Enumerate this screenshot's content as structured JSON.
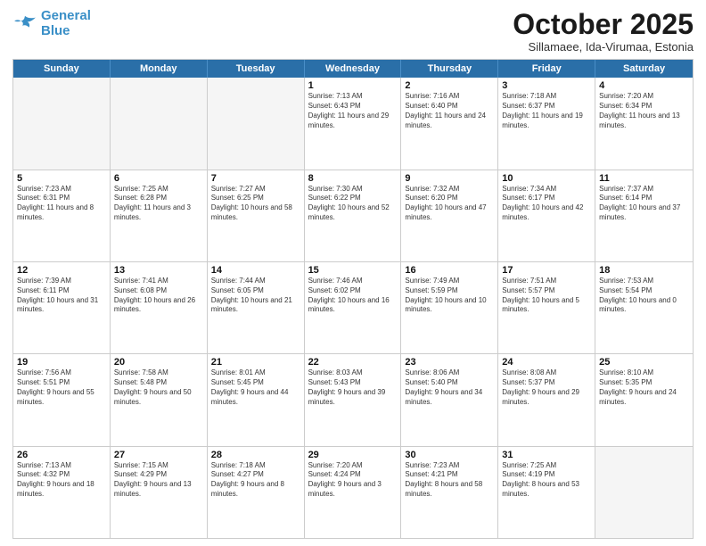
{
  "logo": {
    "line1": "General",
    "line2": "Blue"
  },
  "title": "October 2025",
  "subtitle": "Sillamaee, Ida-Virumaa, Estonia",
  "days": [
    "Sunday",
    "Monday",
    "Tuesday",
    "Wednesday",
    "Thursday",
    "Friday",
    "Saturday"
  ],
  "weeks": [
    [
      {
        "day": "",
        "empty": true
      },
      {
        "day": "",
        "empty": true
      },
      {
        "day": "",
        "empty": true
      },
      {
        "day": "1",
        "rise": "7:13 AM",
        "set": "6:43 PM",
        "daylight": "11 hours and 29 minutes."
      },
      {
        "day": "2",
        "rise": "7:16 AM",
        "set": "6:40 PM",
        "daylight": "11 hours and 24 minutes."
      },
      {
        "day": "3",
        "rise": "7:18 AM",
        "set": "6:37 PM",
        "daylight": "11 hours and 19 minutes."
      },
      {
        "day": "4",
        "rise": "7:20 AM",
        "set": "6:34 PM",
        "daylight": "11 hours and 13 minutes."
      }
    ],
    [
      {
        "day": "5",
        "rise": "7:23 AM",
        "set": "6:31 PM",
        "daylight": "11 hours and 8 minutes."
      },
      {
        "day": "6",
        "rise": "7:25 AM",
        "set": "6:28 PM",
        "daylight": "11 hours and 3 minutes."
      },
      {
        "day": "7",
        "rise": "7:27 AM",
        "set": "6:25 PM",
        "daylight": "10 hours and 58 minutes."
      },
      {
        "day": "8",
        "rise": "7:30 AM",
        "set": "6:22 PM",
        "daylight": "10 hours and 52 minutes."
      },
      {
        "day": "9",
        "rise": "7:32 AM",
        "set": "6:20 PM",
        "daylight": "10 hours and 47 minutes."
      },
      {
        "day": "10",
        "rise": "7:34 AM",
        "set": "6:17 PM",
        "daylight": "10 hours and 42 minutes."
      },
      {
        "day": "11",
        "rise": "7:37 AM",
        "set": "6:14 PM",
        "daylight": "10 hours and 37 minutes."
      }
    ],
    [
      {
        "day": "12",
        "rise": "7:39 AM",
        "set": "6:11 PM",
        "daylight": "10 hours and 31 minutes."
      },
      {
        "day": "13",
        "rise": "7:41 AM",
        "set": "6:08 PM",
        "daylight": "10 hours and 26 minutes."
      },
      {
        "day": "14",
        "rise": "7:44 AM",
        "set": "6:05 PM",
        "daylight": "10 hours and 21 minutes."
      },
      {
        "day": "15",
        "rise": "7:46 AM",
        "set": "6:02 PM",
        "daylight": "10 hours and 16 minutes."
      },
      {
        "day": "16",
        "rise": "7:49 AM",
        "set": "5:59 PM",
        "daylight": "10 hours and 10 minutes."
      },
      {
        "day": "17",
        "rise": "7:51 AM",
        "set": "5:57 PM",
        "daylight": "10 hours and 5 minutes."
      },
      {
        "day": "18",
        "rise": "7:53 AM",
        "set": "5:54 PM",
        "daylight": "10 hours and 0 minutes."
      }
    ],
    [
      {
        "day": "19",
        "rise": "7:56 AM",
        "set": "5:51 PM",
        "daylight": "9 hours and 55 minutes."
      },
      {
        "day": "20",
        "rise": "7:58 AM",
        "set": "5:48 PM",
        "daylight": "9 hours and 50 minutes."
      },
      {
        "day": "21",
        "rise": "8:01 AM",
        "set": "5:45 PM",
        "daylight": "9 hours and 44 minutes."
      },
      {
        "day": "22",
        "rise": "8:03 AM",
        "set": "5:43 PM",
        "daylight": "9 hours and 39 minutes."
      },
      {
        "day": "23",
        "rise": "8:06 AM",
        "set": "5:40 PM",
        "daylight": "9 hours and 34 minutes."
      },
      {
        "day": "24",
        "rise": "8:08 AM",
        "set": "5:37 PM",
        "daylight": "9 hours and 29 minutes."
      },
      {
        "day": "25",
        "rise": "8:10 AM",
        "set": "5:35 PM",
        "daylight": "9 hours and 24 minutes."
      }
    ],
    [
      {
        "day": "26",
        "rise": "7:13 AM",
        "set": "4:32 PM",
        "daylight": "9 hours and 18 minutes."
      },
      {
        "day": "27",
        "rise": "7:15 AM",
        "set": "4:29 PM",
        "daylight": "9 hours and 13 minutes."
      },
      {
        "day": "28",
        "rise": "7:18 AM",
        "set": "4:27 PM",
        "daylight": "9 hours and 8 minutes."
      },
      {
        "day": "29",
        "rise": "7:20 AM",
        "set": "4:24 PM",
        "daylight": "9 hours and 3 minutes."
      },
      {
        "day": "30",
        "rise": "7:23 AM",
        "set": "4:21 PM",
        "daylight": "8 hours and 58 minutes."
      },
      {
        "day": "31",
        "rise": "7:25 AM",
        "set": "4:19 PM",
        "daylight": "8 hours and 53 minutes."
      },
      {
        "day": "",
        "empty": true
      }
    ]
  ]
}
